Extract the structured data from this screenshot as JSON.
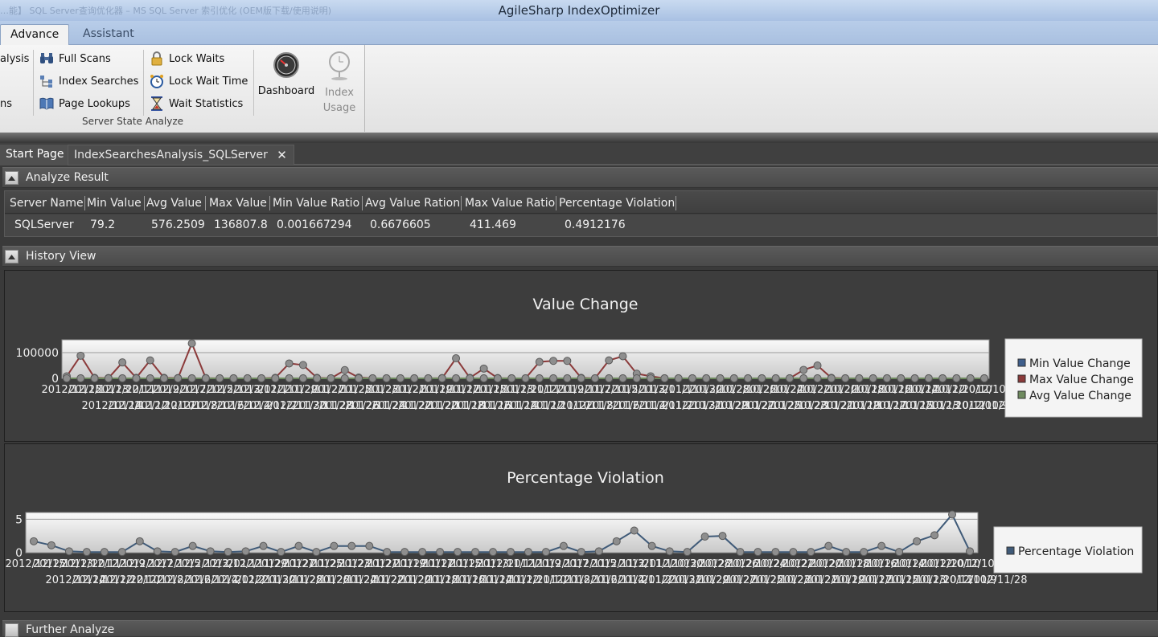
{
  "window": {
    "title": "AgileSharp IndexOptimizer",
    "background_tabs": "…能】 SQL Server查询优化器 – MS SQL Server 索引优化 (OEM版下载/使用说明)"
  },
  "ribbon": {
    "tabs": [
      {
        "label": "Advance",
        "active": true
      },
      {
        "label": "Assistant",
        "active": false
      }
    ],
    "left_partial": [
      "alysis",
      "ns"
    ],
    "col1": [
      "Full Scans",
      "Index Searches",
      "Page Lookups"
    ],
    "col2": [
      "Lock Waits",
      "Lock Wait Time",
      "Wait Statistics"
    ],
    "group_label": "Server State Analyze",
    "dashboard_label": "Dashboard",
    "index_usage_label_1": "Index",
    "index_usage_label_2": "Usage"
  },
  "doc_tabs": [
    {
      "label": "Start Page"
    },
    {
      "label": "IndexSearchesAnalysis_SQLServer",
      "closable": true
    }
  ],
  "analyze_result": {
    "header": "Analyze Result",
    "columns": [
      "Server Name",
      "Min Value",
      "Avg Value",
      "Max Value",
      "Min Value Ratio",
      "Avg Value Ration",
      "Max Value Ratio",
      "Percentage Violation"
    ],
    "row": [
      "SQLServer",
      "79.2",
      "576.2509",
      "136807.8",
      "0.001667294",
      "0.6676605",
      "411.469",
      "0.4912176"
    ]
  },
  "history_view": {
    "header": "History View"
  },
  "further_analyze": {
    "header": "Further Analyze"
  },
  "colors": {
    "min_series": "#3f5f8c",
    "max_series": "#8b3a3a",
    "avg_series": "#6e8a5e",
    "violation_series": "#3f5a78"
  },
  "chart_data": [
    {
      "type": "line",
      "title": "Value Change",
      "yticks": [
        "100000",
        "0"
      ],
      "ylim": [
        0,
        150000
      ],
      "xtick_row1": "2012/12/15 2012/12/13 2012/12/11 2012/12/9 2012/12/7 2012/12/5 2012/12/3 2012/12/1 2012/11/29 2012/11/27 2012/11/25 2012/11/23 2012/11/21 2012/11/19 2012/11/17 2012/11/15 2012/11/13 2012/11/11 2012/11/9 2012/11/7 2012/11/5 2012/11/3 2012/11/1 2012/10/30 2012/10/28 2012/10/26 2012/10/24 2012/10/22 2012/10/20 2012/10/18 2012/10/16 2012/10/14 2012/10/12 2012/10/10 2012/10/8",
      "xtick_row2": "2012/12/14 2012/12/12 2012/12/10 2012/12/8 2012/12/6 2012/12/4 2012/12/2 2012/11/30 2012/11/28 2012/11/26 2012/11/24 2012/11/22 2012/11/20 2012/11/18 2012/11/16 2012/11/14 2012/11/12 2012/11/10 2012/11/8 2012/11/6 2012/11/4 2012/11/2 2012/10/31 2012/10/29 2012/10/27 2012/10/25 2012/10/23 2012/10/21 2012/10/19 2012/10/17 2012/10/15 2012/10/13 2012/10/11 2012/10/9 2012/11/28",
      "series": [
        {
          "name": "Min Value Change",
          "values": [
            0,
            0,
            0,
            0,
            0,
            0,
            0,
            0,
            0,
            0,
            0,
            0,
            0,
            0,
            0,
            0,
            0,
            0,
            0,
            0,
            0,
            0,
            0,
            0,
            0,
            0,
            0,
            0,
            0,
            0,
            0,
            0,
            0,
            0,
            0,
            0,
            0,
            0,
            0,
            0,
            0,
            0,
            0,
            0,
            0,
            0,
            0,
            0,
            0,
            0,
            0,
            0,
            0,
            0,
            0,
            0,
            0,
            0,
            0,
            0,
            0,
            0,
            0,
            0,
            0,
            0,
            0
          ]
        },
        {
          "name": "Max Value Change",
          "values": [
            8000,
            88000,
            2000,
            1000,
            62000,
            2000,
            70000,
            2000,
            1000,
            136000,
            1000,
            0,
            0,
            0,
            0,
            2000,
            58000,
            52000,
            2000,
            0,
            32000,
            3000,
            0,
            0,
            0,
            0,
            0,
            1000,
            78000,
            2000,
            38000,
            1000,
            0,
            0,
            64000,
            68000,
            68000,
            2000,
            0,
            70000,
            86000,
            18000,
            8000,
            0,
            0,
            0,
            0,
            0,
            0,
            0,
            0,
            0,
            0,
            33000,
            50000,
            2000,
            0,
            0,
            0,
            0,
            0,
            0,
            0,
            0,
            0,
            0,
            0
          ]
        },
        {
          "name": "Avg Value Change",
          "values": [
            0,
            0,
            0,
            0,
            0,
            0,
            0,
            0,
            0,
            0,
            0,
            0,
            0,
            0,
            0,
            0,
            0,
            0,
            0,
            0,
            0,
            0,
            0,
            0,
            0,
            0,
            0,
            0,
            0,
            0,
            0,
            0,
            0,
            0,
            0,
            0,
            0,
            0,
            0,
            0,
            0,
            0,
            0,
            0,
            0,
            0,
            0,
            0,
            0,
            0,
            0,
            0,
            0,
            0,
            0,
            0,
            0,
            0,
            0,
            0,
            0,
            0,
            0,
            0,
            0,
            0,
            0
          ]
        }
      ]
    },
    {
      "type": "line",
      "title": "Percentage Violation",
      "yticks": [
        "5",
        "0"
      ],
      "ylim": [
        0,
        6
      ],
      "xtick_row1": "2012/12/15 2012/12/13 2012/12/11 2012/12/9 2012/12/7 2012/12/5 2012/12/3 2012/12/1 2012/11/29 2012/11/27 2012/11/25 2012/11/23 2012/11/21 2012/11/19 2012/11/17 2012/11/15 2012/11/13 2012/11/11 2012/11/9 2012/11/7 2012/11/5 2012/11/3 2012/11/1 2012/10/30 2012/10/28 2012/10/26 2012/10/24 2012/10/22 2012/10/20 2012/10/18 2012/10/16 2012/10/14 2012/10/12 2012/10/10 2012/10/8",
      "xtick_row2": "2012/12/14 2012/12/12 2012/12/10 2012/12/8 2012/12/6 2012/12/4 2012/12/2 2012/11/30 2012/11/28 2012/11/26 2012/11/24 2012/11/22 2012/11/20 2012/11/18 2012/11/16 2012/11/14 2012/11/12 2012/11/10 2012/11/8 2012/11/6 2012/11/4 2012/11/2 2012/10/31 2012/10/29 2012/10/27 2012/10/25 2012/10/23 2012/10/21 2012/10/19 2012/10/17 2012/10/15 2012/10/13 2012/10/11 2012/10/9 2012/11/28",
      "series": [
        {
          "name": "Percentage Violation",
          "values": [
            1.7,
            1.1,
            0.2,
            0.1,
            0.1,
            0.1,
            1.7,
            0.2,
            0.1,
            1.0,
            0.2,
            0.1,
            0.2,
            1.0,
            0.1,
            1.0,
            0.1,
            1.0,
            1.0,
            1.0,
            0.1,
            0.1,
            0.1,
            0.1,
            0.1,
            0.1,
            0.1,
            0.1,
            0.1,
            0.1,
            1.0,
            0.1,
            0.2,
            1.7,
            3.3,
            1.0,
            0.2,
            0.1,
            2.4,
            2.5,
            0.1,
            0.1,
            0.1,
            0.1,
            0.1,
            1.0,
            0.1,
            0.1,
            1.0,
            0.1,
            1.7,
            2.6,
            5.7,
            0.2
          ]
        }
      ]
    }
  ]
}
